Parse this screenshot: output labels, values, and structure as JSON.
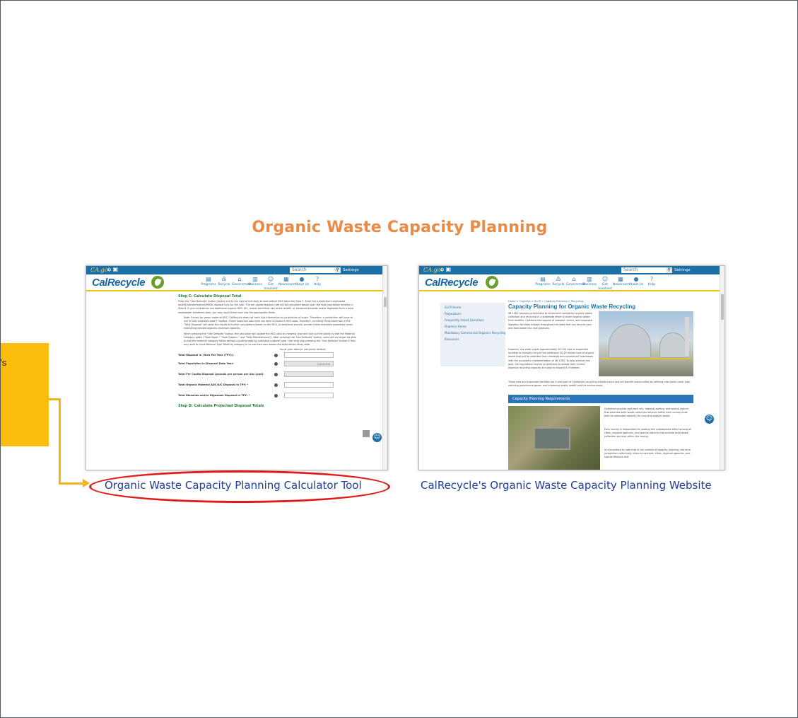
{
  "slide": {
    "title": "Organic Waste Capacity Planning",
    "callout_lines": [
      "e's",
      "",
      "g"
    ],
    "left_caption": "Organic Waste Capacity Planning Calculator Tool",
    "right_caption": "CalRecycle's Organic Waste Capacity Planning Website"
  },
  "site_header": {
    "ca_logo": "CA.gov",
    "search_placeholder": "Search",
    "settings_label": "Settings",
    "brand": "CalRecycle",
    "nav": [
      "Programs",
      "Recycle",
      "Government",
      "Business",
      "Get Involved",
      "Newsroom",
      "About Us",
      "Help"
    ]
  },
  "calculator": {
    "step_c": "Step C: Calculate Disposal Total",
    "intro": "Press the \"Use Defaults\" button (above and to the right of this text) to load default MCS data into Step C. Enter the jurisdiction's estimated landfill/transformation/EMSW disposal tons for the year. The per capita disposal rate will be calculated based upon the total population entered in Step B. If your jurisdiction has additional organic ADC, AIC, and/or beneficial use at the landfill, or disposed biosolids and/or digestate from a local wastewater treatment plan, you may input these tons into the appropriate fields.",
    "bullet1": "Note: Except for green material ADC, CalRecycle does not track this information by jurisdiction of origin. Therefore, a jurisdiction will have to use its own available data if needed. These materials also have not been included in MCS data. Therefore, including these materials in the \"Total Disposal\" will skew the results of further calculations based on the MCS. Jurisdictions should consider these materials separately when estimating needed organics diversion capacity.",
    "bullet2": "When pressing the \"Use Defaults\" button, the calculator will update the MCS data by material type and lock out the ability to edit the Material Category totals (\"Total Paper,\" \"Total Organic,\" and \"Total Miscellaneous\"). After pressing the \"Use Defaults\" button, users will no longer be able to edit the material category totals without inputting data by individual material type. User may skip pressing the \"Use Defaults\" button if they only wish to input Material Type Totals by category or to use their own waste characterization study data.",
    "input_hint": "Input your data or carryover default",
    "fields": [
      {
        "label": "Total Disposal in (Tons Per Year (TPY)):",
        "value": ""
      },
      {
        "label": "Total Population in Disposal Data Year:",
        "value": "2,000,000"
      },
      {
        "label": "Total Per Capita Disposal (pounds per person per day (ppd):",
        "value": ""
      },
      {
        "label": "Total Organic Material ADC/AIC Disposal in TPY: *",
        "value": ""
      },
      {
        "label": "Total Biosolids and/or Digestate Disposal in TPY: *",
        "value": ""
      }
    ],
    "step_d": "Step D: Calculate Projected Disposal Totals"
  },
  "website": {
    "breadcrumb": "Home > Organics > SLCP > Capacity Planning > Recycling",
    "title": "Capacity Planning for Organic Waste Recycling",
    "sidebar_links": [
      "SLCP Home",
      "Regulations",
      "Frequently Asked Questions",
      "Organics Home",
      "Mandatory Commercial Organics Recycling",
      "Resources"
    ],
    "para1": "SB 1383 requires jurisdictions to implement mandatory organic waste collection and recycling in a statewide effort to divert organic waste from landfills. California has dozens of compost, mulch, and anaerobic digestion facilities located throughout the state that can recycle yard and food waste into new products.",
    "para2": "However, the state needs approximately 50-100 new or expanded facilities to annually recycle the additional 20-25 million tons of organic waste that will be collected from residents and commercial businesses with the successful implementation of SB 1383. To help achieve this goal, the regulations require jurisdictions to assess their current organics recycling capacity and plan to expand it if needed.",
    "para3": "These new and expanded facilities are a vital part of California's recycling infrastructure and will benefit communities by offering new green collar jobs, reducing greenhouse gases, and improving public health and the environment.",
    "banner": "Capacity Planning Requirements",
    "req1": "California counties and each city, regional agency, and special district that provides solid waste collection services within each county must plan for adequate capacity for recycling organic waste.",
    "req2": "Each county is responsible for leading this collaborative effort among all cities, regional agencies, and special districts that provide solid waste collection services within the county.",
    "req3": "It is important to note that in the context of capacity planning, the term jurisdiction collectively refers to counties, cities, regional agencies, and special districts that"
  }
}
